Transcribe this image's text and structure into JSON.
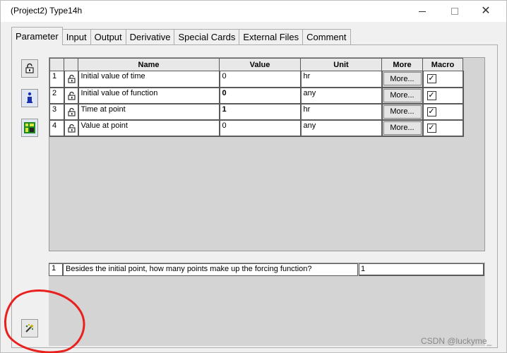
{
  "window": {
    "title": "(Project2) Type14h"
  },
  "tabs": [
    {
      "label": "Parameter",
      "active": true
    },
    {
      "label": "Input"
    },
    {
      "label": "Output"
    },
    {
      "label": "Derivative"
    },
    {
      "label": "Special Cards"
    },
    {
      "label": "External Files"
    },
    {
      "label": "Comment"
    }
  ],
  "sidebar": {
    "icons": [
      "lock-icon",
      "info-icon",
      "grid-icon",
      "wand-icon"
    ]
  },
  "parameters": {
    "headers": {
      "name": "Name",
      "value": "Value",
      "unit": "Unit",
      "more": "More",
      "macro": "Macro"
    },
    "more_label": "More...",
    "rows": [
      {
        "num": "1",
        "name": "Initial value of time",
        "value": "0",
        "unit": "hr",
        "macro": true,
        "value_bold": false
      },
      {
        "num": "2",
        "name": "Initial value of function",
        "value": "0",
        "unit": "any",
        "macro": true,
        "value_bold": true
      },
      {
        "num": "3",
        "name": "Time at point",
        "value": "1",
        "unit": "hr",
        "macro": true,
        "value_bold": true
      },
      {
        "num": "4",
        "name": "Value at point",
        "value": "0",
        "unit": "any",
        "macro": true,
        "value_bold": false
      }
    ]
  },
  "question": {
    "num": "1",
    "text": "Besides the initial point, how many points make up the forcing function?",
    "value": "1"
  },
  "watermark": "CSDN @luckyme_",
  "annotation": {
    "color": "#e8201e"
  }
}
